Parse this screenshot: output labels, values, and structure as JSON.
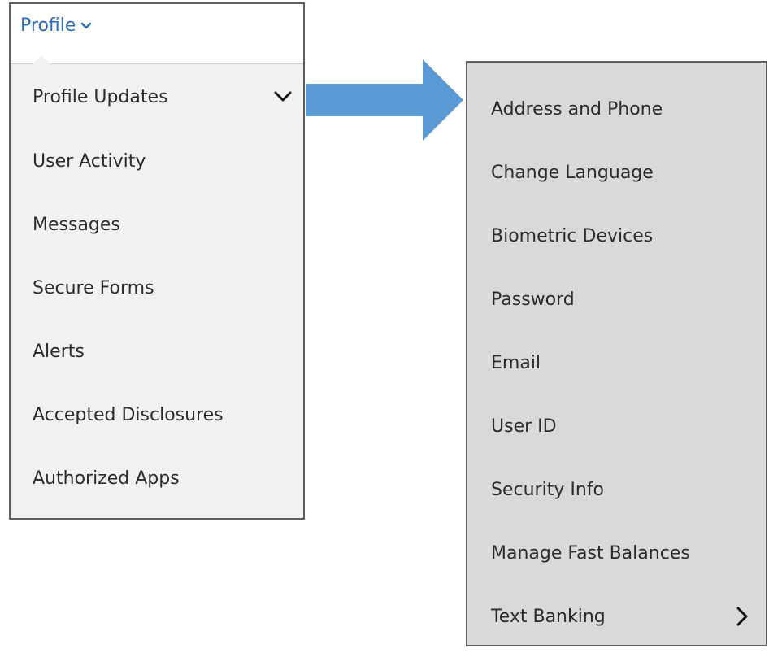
{
  "profile_menu": {
    "title": "Profile",
    "title_icon": "chevron-down-icon",
    "items": [
      {
        "label": "Profile Updates",
        "icon": "chevron-down-icon"
      },
      {
        "label": "User Activity"
      },
      {
        "label": "Messages"
      },
      {
        "label": "Secure Forms"
      },
      {
        "label": "Alerts"
      },
      {
        "label": "Accepted Disclosures"
      },
      {
        "label": "Authorized Apps"
      }
    ]
  },
  "arrow": {
    "icon": "arrow-right-icon",
    "color": "#5b9bd5"
  },
  "profile_updates_submenu": {
    "items": [
      {
        "label": "Address and Phone"
      },
      {
        "label": "Change Language"
      },
      {
        "label": "Biometric Devices"
      },
      {
        "label": "Password"
      },
      {
        "label": "Email"
      },
      {
        "label": "User ID"
      },
      {
        "label": "Security Info"
      },
      {
        "label": "Manage Fast Balances"
      },
      {
        "label": "Text Banking",
        "icon": "chevron-right-icon"
      }
    ]
  },
  "colors": {
    "link": "#2d6db5",
    "left_panel_bg": "#f1f1f1",
    "right_panel_bg": "#d9d9d9",
    "border": "#5f5f5f",
    "arrow": "#5b9bd5"
  }
}
